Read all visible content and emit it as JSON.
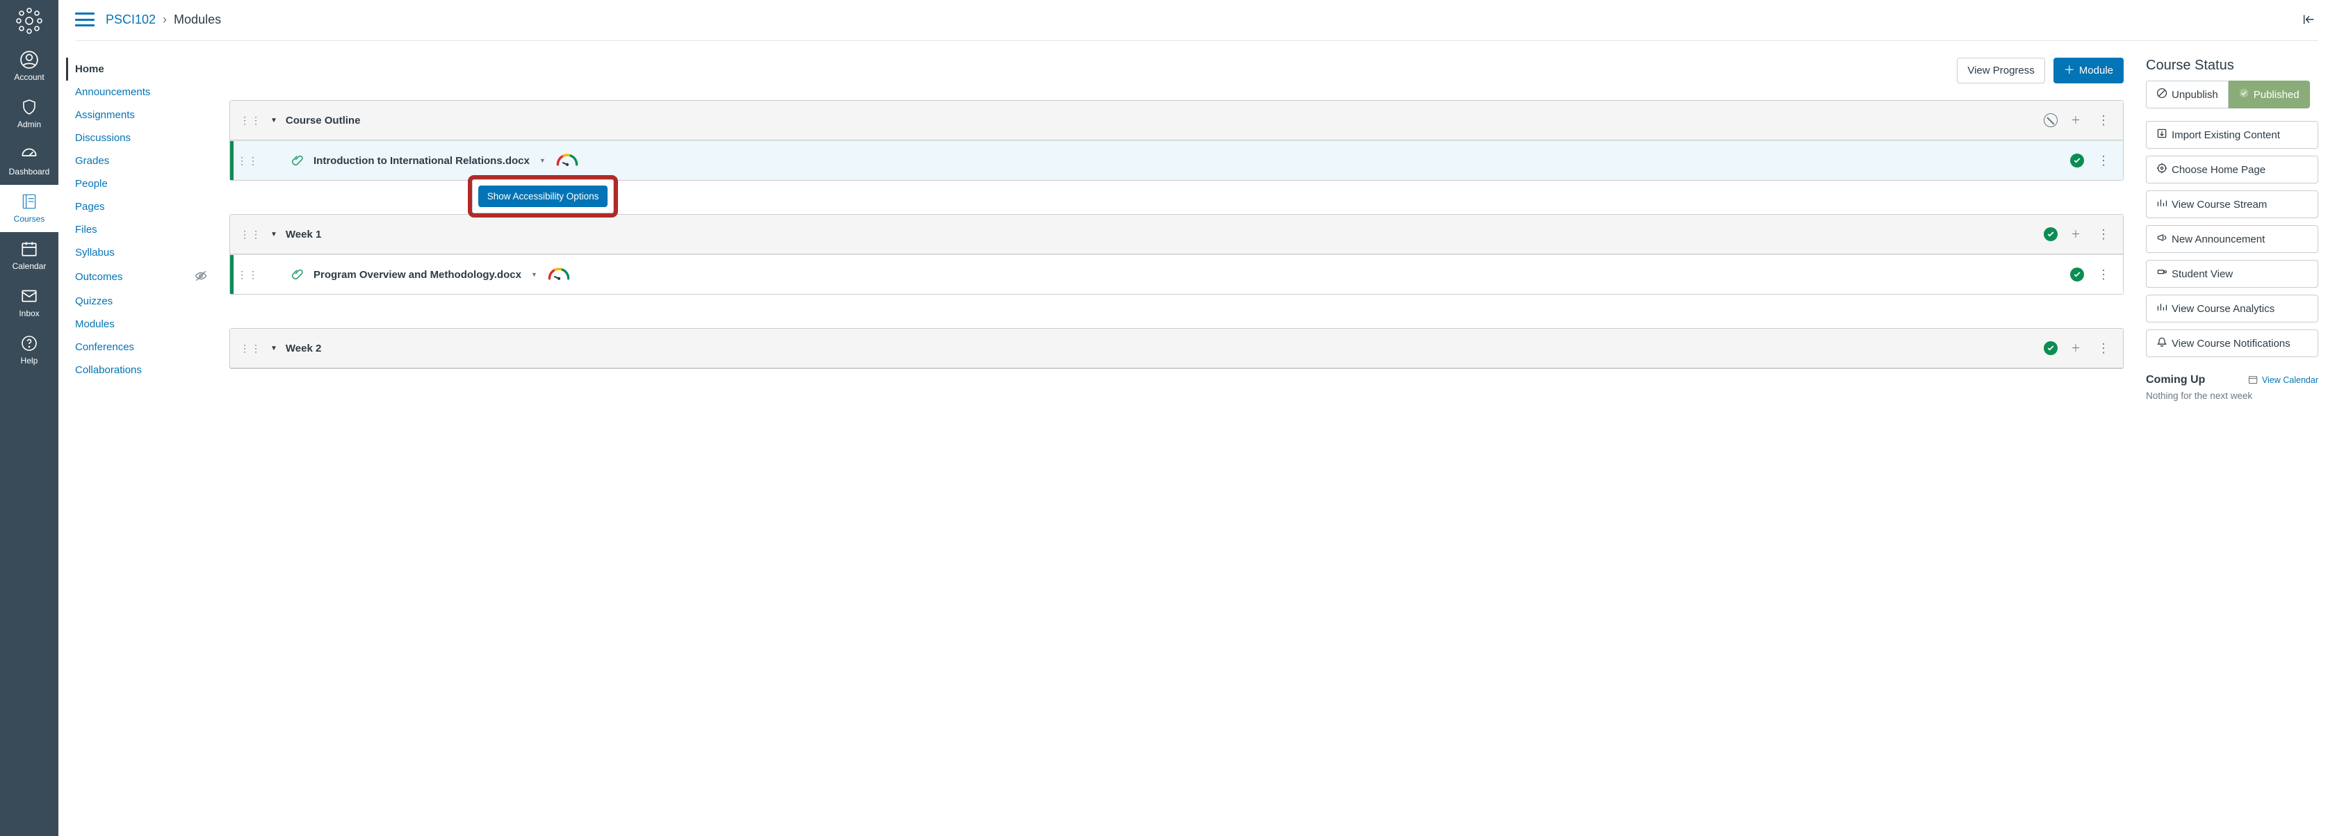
{
  "global_nav": {
    "items": [
      {
        "id": "account",
        "label": "Account"
      },
      {
        "id": "admin",
        "label": "Admin"
      },
      {
        "id": "dashboard",
        "label": "Dashboard"
      },
      {
        "id": "courses",
        "label": "Courses"
      },
      {
        "id": "calendar",
        "label": "Calendar"
      },
      {
        "id": "inbox",
        "label": "Inbox"
      },
      {
        "id": "help",
        "label": "Help"
      }
    ]
  },
  "breadcrumb": {
    "course_code": "PSCI102",
    "separator": "›",
    "page": "Modules"
  },
  "course_nav": {
    "items": [
      {
        "label": "Home",
        "current": true,
        "hidden": false
      },
      {
        "label": "Announcements",
        "current": false,
        "hidden": false
      },
      {
        "label": "Assignments",
        "current": false,
        "hidden": false
      },
      {
        "label": "Discussions",
        "current": false,
        "hidden": false
      },
      {
        "label": "Grades",
        "current": false,
        "hidden": false
      },
      {
        "label": "People",
        "current": false,
        "hidden": false
      },
      {
        "label": "Pages",
        "current": false,
        "hidden": false
      },
      {
        "label": "Files",
        "current": false,
        "hidden": false
      },
      {
        "label": "Syllabus",
        "current": false,
        "hidden": false
      },
      {
        "label": "Outcomes",
        "current": false,
        "hidden": true
      },
      {
        "label": "Quizzes",
        "current": false,
        "hidden": false
      },
      {
        "label": "Modules",
        "current": false,
        "hidden": false
      },
      {
        "label": "Conferences",
        "current": false,
        "hidden": false
      },
      {
        "label": "Collaborations",
        "current": false,
        "hidden": false
      }
    ]
  },
  "main_header": {
    "view_progress": "View Progress",
    "add_module": "Module"
  },
  "modules": [
    {
      "title": "Course Outline",
      "header_published": false,
      "items": [
        {
          "name": "Introduction to International Relations.docx",
          "published": true,
          "selected": true,
          "has_gauge": true
        }
      ]
    },
    {
      "title": "Week 1",
      "header_published": true,
      "items": [
        {
          "name": "Program Overview and Methodology.docx",
          "published": true,
          "selected": false,
          "has_gauge": true
        }
      ]
    },
    {
      "title": "Week 2",
      "header_published": true,
      "items": []
    }
  ],
  "a11y_popover": {
    "label": "Show Accessibility Options"
  },
  "sidebar": {
    "status_heading": "Course Status",
    "unpublish": "Unpublish",
    "published": "Published",
    "actions": [
      {
        "id": "import",
        "label": "Import Existing Content"
      },
      {
        "id": "choose-home",
        "label": "Choose Home Page"
      },
      {
        "id": "stream",
        "label": "View Course Stream"
      },
      {
        "id": "announcement",
        "label": "New Announcement"
      },
      {
        "id": "student-view",
        "label": "Student View"
      },
      {
        "id": "analytics",
        "label": "View Course Analytics"
      },
      {
        "id": "notifications",
        "label": "View Course Notifications"
      }
    ],
    "coming_up": "Coming Up",
    "view_calendar": "View Calendar",
    "nothing": "Nothing for the next week"
  }
}
